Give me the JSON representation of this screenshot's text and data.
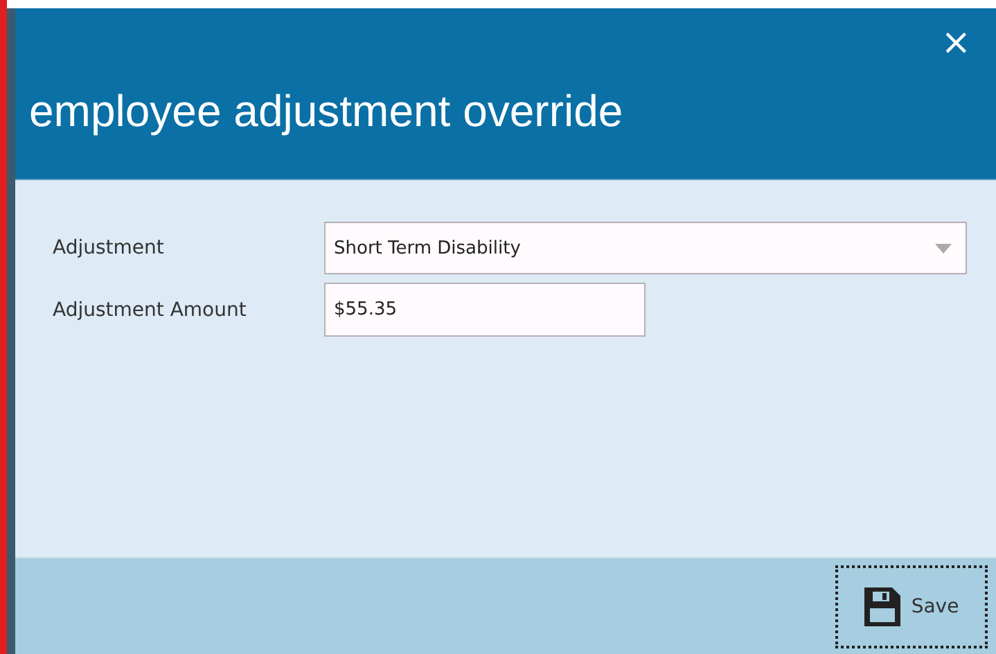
{
  "dialog": {
    "title": "employee adjustment override",
    "close": "×"
  },
  "fields": [
    {
      "kind": "select",
      "label": "Adjustment",
      "value": "Short Term Disability"
    },
    {
      "kind": "text",
      "label": "Adjustment Amount",
      "value": "$55.35"
    }
  ],
  "footer": {
    "save": "Save"
  }
}
